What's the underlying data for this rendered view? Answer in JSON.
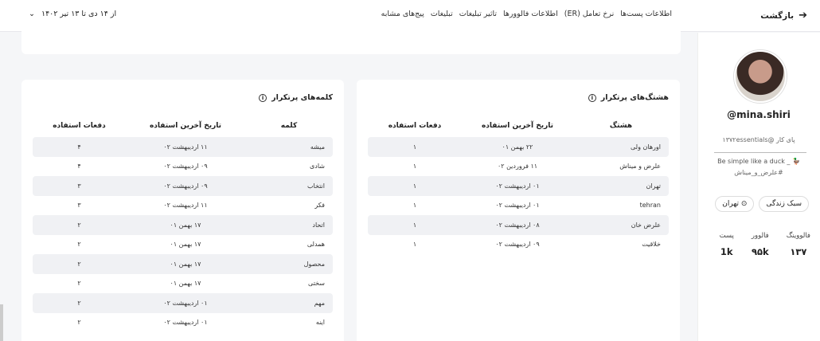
{
  "topbar": {
    "back_label": "بازگشت",
    "back_icon": "arrow-right",
    "tabs": [
      "اطلاعات پست‌ها",
      "نرخ تعامل (ER)",
      "اطلاعات فالوورها",
      "تاثیر تبلیغات",
      "تبلیغات",
      "پیج‌های مشابه"
    ],
    "date_range": "از ۱۴ دی تا ۱۳ تیر ۱۴۰۲",
    "date_chevron": "⌄"
  },
  "profile": {
    "username": "@mina.shiri",
    "bio_line1": "پای کار @۱۳۷۲essentials",
    "bio_line2": "Be simple like a duck _ 🦆",
    "bio_line3": "#علرض_و_میناش",
    "chips": [
      {
        "label": "سبک زندگی"
      },
      {
        "label": "تهران",
        "icon": "⊙"
      }
    ],
    "stats": [
      {
        "label": "فالووینگ",
        "value": "۱۳۷"
      },
      {
        "label": "فالوور",
        "value": "۹۵k"
      },
      {
        "label": "پست",
        "value": "1k"
      }
    ]
  },
  "hashtags": {
    "title": "هشتگ‌های پرتکرار",
    "info": "i",
    "headers": [
      "هشتگ",
      "تاریخ آخرین استفاده",
      "دفعات استفاده"
    ],
    "rows": [
      [
        "اورهان ولی",
        "۲۲ بهمن ۰۱",
        "۱"
      ],
      [
        "علرض و میناش",
        "۱۱ فروردین ۰۲",
        "۱"
      ],
      [
        "تهران",
        "۰۱ اردیبهشت ۰۲",
        "۱"
      ],
      [
        "tehran",
        "۰۱ اردیبهشت ۰۲",
        "۱"
      ],
      [
        "علرض خان",
        "۰۸ اردیبهشت ۰۲",
        "۱"
      ],
      [
        "خلاقیت",
        "۰۹ اردیبهشت ۰۲",
        "۱"
      ]
    ]
  },
  "words": {
    "title": "کلمه‌های پرتکرار",
    "info": "i",
    "headers": [
      "کلمه",
      "تاریخ آخرین استفاده",
      "دفعات استفاده"
    ],
    "rows": [
      [
        "میشه",
        "۱۱ اردیبهشت ۰۲",
        "۴"
      ],
      [
        "شادی",
        "۰۹ اردیبهشت ۰۲",
        "۴"
      ],
      [
        "انتخاب",
        "۰۹ اردیبهشت ۰۲",
        "۳"
      ],
      [
        "فکر",
        "۱۱ اردیبهشت ۰۲",
        "۳"
      ],
      [
        "اتحاد",
        "۱۷ بهمن ۰۱",
        "۲"
      ],
      [
        "همدلی",
        "۱۷ بهمن ۰۱",
        "۲"
      ],
      [
        "محصول",
        "۱۷ بهمن ۰۱",
        "۲"
      ],
      [
        "سختی",
        "۱۷ بهمن ۰۱",
        "۲"
      ],
      [
        "مهم",
        "۰۱ اردیبهشت ۰۲",
        "۲"
      ],
      [
        "اینه",
        "۰۱ اردیبهشت ۰۲",
        "۲"
      ]
    ]
  }
}
